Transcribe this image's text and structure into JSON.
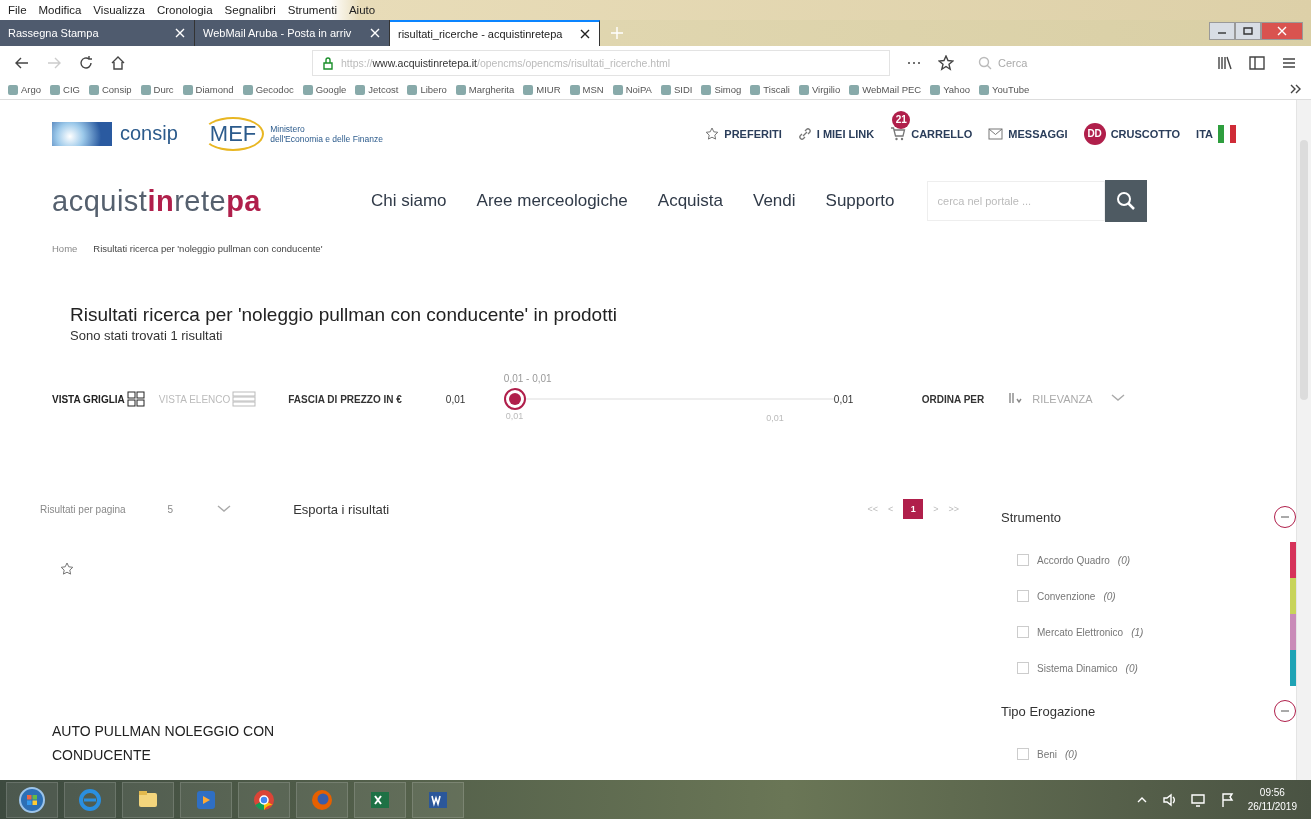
{
  "browser": {
    "menu": [
      "File",
      "Modifica",
      "Visualizza",
      "Cronologia",
      "Segnalibri",
      "Strumenti",
      "Aiuto"
    ],
    "tabs": [
      {
        "title": "Rassegna Stampa",
        "selected": false
      },
      {
        "title": "WebMail Aruba - Posta in arriv",
        "selected": false
      },
      {
        "title": "risultati_ricerche - acquistinretepa",
        "selected": true
      }
    ],
    "url": "https://www.acquistinretepa.it/opencms/opencms/risultati_ricerche.html",
    "search_placeholder": "Cerca",
    "bookmarks": [
      "Argo",
      "CIG",
      "Consip",
      "Durc",
      "Diamond",
      "Gecodoc",
      "Google",
      "Jetcost",
      "Libero",
      "Margherita",
      "MIUR",
      "MSN",
      "NoiPA",
      "SIDI",
      "Simog",
      "Tiscali",
      "Virgilio",
      "WebMail PEC",
      "Yahoo",
      "YouTube"
    ]
  },
  "header": {
    "consip": "consip",
    "mef": "MEF",
    "ministry": [
      "Ministero",
      "dell'Economia e delle Finanze"
    ],
    "links": [
      {
        "label": "PREFERITI",
        "kind": "star"
      },
      {
        "label": "I MIEI LINK",
        "kind": "link"
      },
      {
        "label": "CARRELLO",
        "kind": "cart",
        "badge": "21"
      },
      {
        "label": "MESSAGGI",
        "kind": "mail"
      },
      {
        "label": "CRUSCOTTO",
        "kind": "user",
        "initials": "DD"
      }
    ],
    "language": "ITA"
  },
  "nav": {
    "brand": [
      {
        "text": "acquist",
        "accent": false
      },
      {
        "text": "in",
        "accent": true
      },
      {
        "text": "rete",
        "accent": false
      },
      {
        "text": "pa",
        "accent": true
      }
    ],
    "items": [
      "Chi siamo",
      "Aree merceologiche",
      "Acquista",
      "Vendi",
      "Supporto"
    ],
    "search_placeholder": "cerca nel portale ..."
  },
  "breadcrumb": [
    "Home",
    "Risultati ricerca per 'noleggio pullman con conducente'"
  ],
  "title": "Risultati ricerca per 'noleggio pullman con conducente' in prodotti",
  "subtitle": "Sono stati trovati 1 risultati",
  "toolbar": {
    "views": [
      {
        "label": "VISTA GRIGLIA",
        "kind": "grid",
        "selected": true
      },
      {
        "label": "VISTA ELENCO",
        "kind": "list",
        "selected": false
      }
    ],
    "price_label": "FASCIA DI PREZZO IN €",
    "price_min": "0,01",
    "range": "0,01 - 0,01",
    "handle_label": "0,01",
    "end_label": "0,01",
    "price_max": "0,01",
    "sort_label": "ORDINA PER",
    "sort_value": "RILEVANZA"
  },
  "results": {
    "per_page_label": "Risultati per pagina",
    "per_page": "5",
    "export": "Esporta i risultati",
    "pages": [
      {
        "label": "<<",
        "selected": false
      },
      {
        "label": "<",
        "selected": false
      },
      {
        "label": "1",
        "selected": true
      },
      {
        "label": ">",
        "selected": false
      },
      {
        "label": ">>",
        "selected": false
      }
    ]
  },
  "product": {
    "title": "AUTO PULLMAN NOLEGGIO CON CONDUCENTE"
  },
  "filters": [
    {
      "title": "Strumento",
      "expanded": true,
      "items": [
        {
          "label": "Accordo Quadro",
          "count": "(0)",
          "color": "#d6335a"
        },
        {
          "label": "Convenzione",
          "count": "(0)",
          "color": "#c8d45a"
        },
        {
          "label": "Mercato Elettronico",
          "count": "(1)",
          "color": "#c98bb8"
        },
        {
          "label": "Sistema Dinamico",
          "count": "(0)",
          "color": "#1fa3b5"
        }
      ]
    },
    {
      "title": "Tipo Erogazione",
      "expanded": true,
      "items": [
        {
          "label": "Beni",
          "count": "(0)"
        }
      ]
    }
  ],
  "taskbar": {
    "time": "09:56",
    "date": "26/11/2019"
  }
}
